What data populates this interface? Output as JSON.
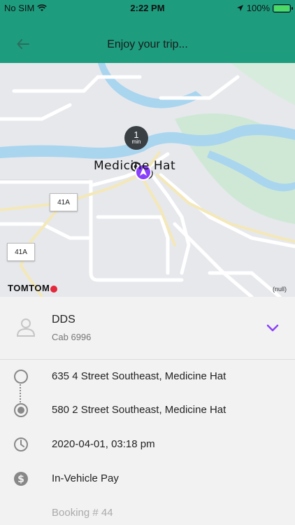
{
  "status_bar": {
    "carrier": "No SIM",
    "time": "2:22 PM",
    "battery": "100%"
  },
  "nav": {
    "title": "Enjoy your trip..."
  },
  "map": {
    "place_label": "Medicine Hat",
    "eta_value": "1",
    "eta_unit": "min",
    "highway_1": "41A",
    "highway_2": "41A",
    "brand": "TOMTOM",
    "null_label": "(null)"
  },
  "driver": {
    "name": "DDS",
    "cab": "Cab 6996"
  },
  "trip": {
    "pickup": "635 4 Street Southeast, Medicine Hat",
    "dropoff": "580 2 Street Southeast, Medicine Hat",
    "datetime": "2020-04-01, 03:18 pm",
    "payment": "In-Vehicle Pay",
    "booking": "Booking # 44"
  },
  "colors": {
    "header": "#1d9c7e",
    "accent": "#8a3ffc",
    "map_water": "#a9d5ef",
    "map_park": "#cfe8d6"
  }
}
